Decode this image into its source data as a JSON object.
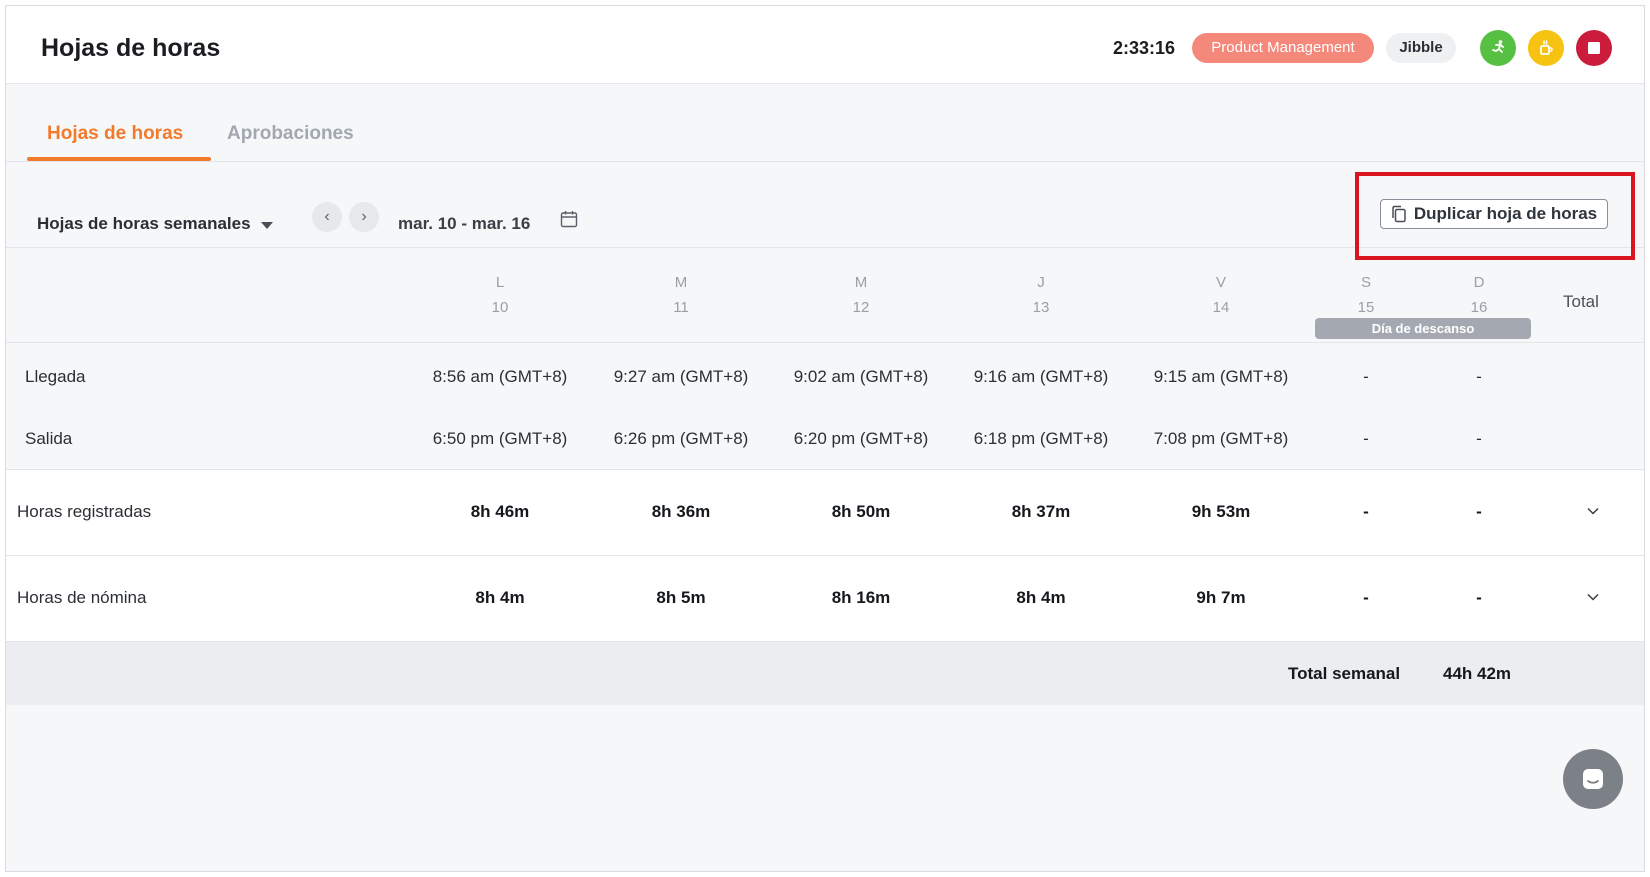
{
  "header": {
    "title": "Hojas de horas",
    "timer": "2:33:16",
    "project_chip": "Product Management",
    "org_chip": "Jibble",
    "icons": [
      "running-icon",
      "coffee-break-icon",
      "stop-icon"
    ],
    "colors": {
      "green": "#56c043",
      "yellow": "#f6c313",
      "red": "#cc1c3c",
      "project": "#f4897b"
    }
  },
  "tabs": [
    {
      "label": "Hojas de horas",
      "active": true
    },
    {
      "label": "Aprobaciones",
      "active": false
    }
  ],
  "toolbar": {
    "view": "Hojas de horas semanales",
    "prev_icon": "‹",
    "next_icon": "›",
    "date_range": "mar. 10 - mar. 16",
    "duplicate_label": "Duplicar hoja de horas"
  },
  "days": [
    {
      "letter": "L",
      "num": "10"
    },
    {
      "letter": "M",
      "num": "11"
    },
    {
      "letter": "M",
      "num": "12"
    },
    {
      "letter": "J",
      "num": "13"
    },
    {
      "letter": "V",
      "num": "14"
    },
    {
      "letter": "S",
      "num": "15"
    },
    {
      "letter": "D",
      "num": "16"
    }
  ],
  "rest_day_label": "Día de descanso",
  "total_label": "Total",
  "rows": {
    "arrival": {
      "label": "Llegada",
      "values": [
        "8:56 am (GMT+8)",
        "9:27 am (GMT+8)",
        "9:02 am (GMT+8)",
        "9:16 am (GMT+8)",
        "9:15 am (GMT+8)",
        "-",
        "-"
      ]
    },
    "departure": {
      "label": "Salida",
      "values": [
        "6:50 pm (GMT+8)",
        "6:26 pm (GMT+8)",
        "6:20 pm (GMT+8)",
        "6:18 pm (GMT+8)",
        "7:08 pm (GMT+8)",
        "-",
        "-"
      ]
    },
    "tracked": {
      "label": "Horas registradas",
      "values": [
        "8h 46m",
        "8h 36m",
        "8h 50m",
        "8h 37m",
        "9h 53m",
        "-",
        "-"
      ]
    },
    "payroll": {
      "label": "Horas de nómina",
      "values": [
        "8h 4m",
        "8h 5m",
        "8h 16m",
        "8h 4m",
        "9h 7m",
        "-",
        "-"
      ]
    }
  },
  "weekly": {
    "label": "Total semanal",
    "value": "44h 42m"
  }
}
